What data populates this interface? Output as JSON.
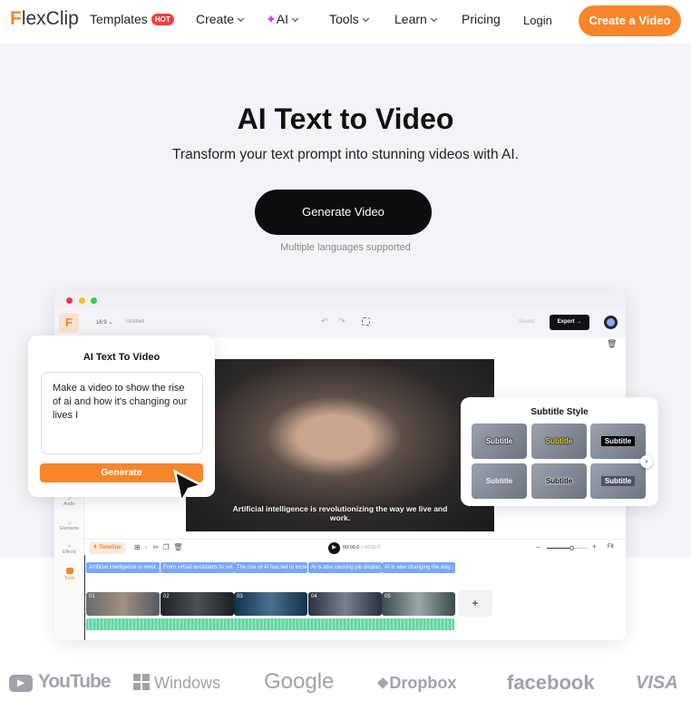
{
  "nav": {
    "logo": "FlexClip",
    "templates": "Templates",
    "hot": "HOT",
    "create": "Create",
    "ai": "AI",
    "tools": "Tools",
    "learn": "Learn",
    "pricing": "Pricing",
    "login": "Login",
    "cta": "Create a Video"
  },
  "hero": {
    "title": "AI Text to Video",
    "subtitle": "Transform your text prompt into stunning videos with AI.",
    "button": "Generate Video",
    "note": "Multiple languages supported"
  },
  "editor": {
    "ratio": "16:9",
    "project": "Untitled",
    "saved": "Saved",
    "export": "Export →",
    "sidebar": [
      "Audio",
      "Elements",
      "Effects",
      "Tools"
    ],
    "caption": "Artificial intelligence is revolutionizing the way we live and work.",
    "timeline_label": "Timeline",
    "time_current": "00:00.0",
    "time_total": "/ 00:25.0",
    "fit": "Fit",
    "captions": [
      "Artificial intelligence is revol...",
      "From virtual assistants to sel...",
      "The rise of AI has led to incre...",
      "AI is also causing job displac...",
      "AI is also changing the way ..."
    ],
    "clips": [
      "01",
      "02",
      "03",
      "04",
      "05"
    ],
    "add": "+"
  },
  "ai_panel": {
    "title": "AI Text To Video",
    "prompt": "Make a video to show the rise of ai and how it's changing our lives",
    "button": "Generate"
  },
  "subtitle_panel": {
    "title": "Subtitle Style",
    "styles": [
      "Subtitle",
      "Subtitle",
      "Subtitle",
      "Subtitle",
      "Subtitle",
      "Subtitle"
    ]
  },
  "logos": [
    "YouTube",
    "Windows",
    "Google",
    "Dropbox",
    "facebook",
    "VISA"
  ],
  "colors": {
    "accent": "#f7862b",
    "dark": "#0d0d0d",
    "hero_bg": "#f3f4fa",
    "caption_chip": "#7aa7f7",
    "audio": "#5fd3a0"
  }
}
